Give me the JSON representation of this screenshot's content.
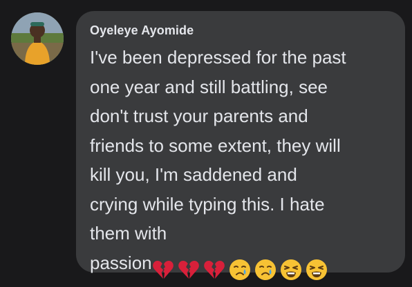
{
  "comment": {
    "author": "Oyeleye Ayomide",
    "lines": [
      "I've been depressed for the past",
      "one year and still battling, see",
      "don't trust your parents and",
      "friends to some extent, they will",
      "kill you, I'm saddened and",
      "crying while typing this. I hate",
      "them with"
    ],
    "last_line_text": "passion",
    "emojis": [
      "broken-heart",
      "broken-heart",
      "broken-heart",
      "crying-face",
      "crying-face",
      "weary-face",
      "weary-face"
    ]
  },
  "colors": {
    "background": "#19191b",
    "bubble": "#3a3b3d",
    "text": "#e4e6eb",
    "heart": "#d8203a",
    "face": "#f7c234"
  }
}
